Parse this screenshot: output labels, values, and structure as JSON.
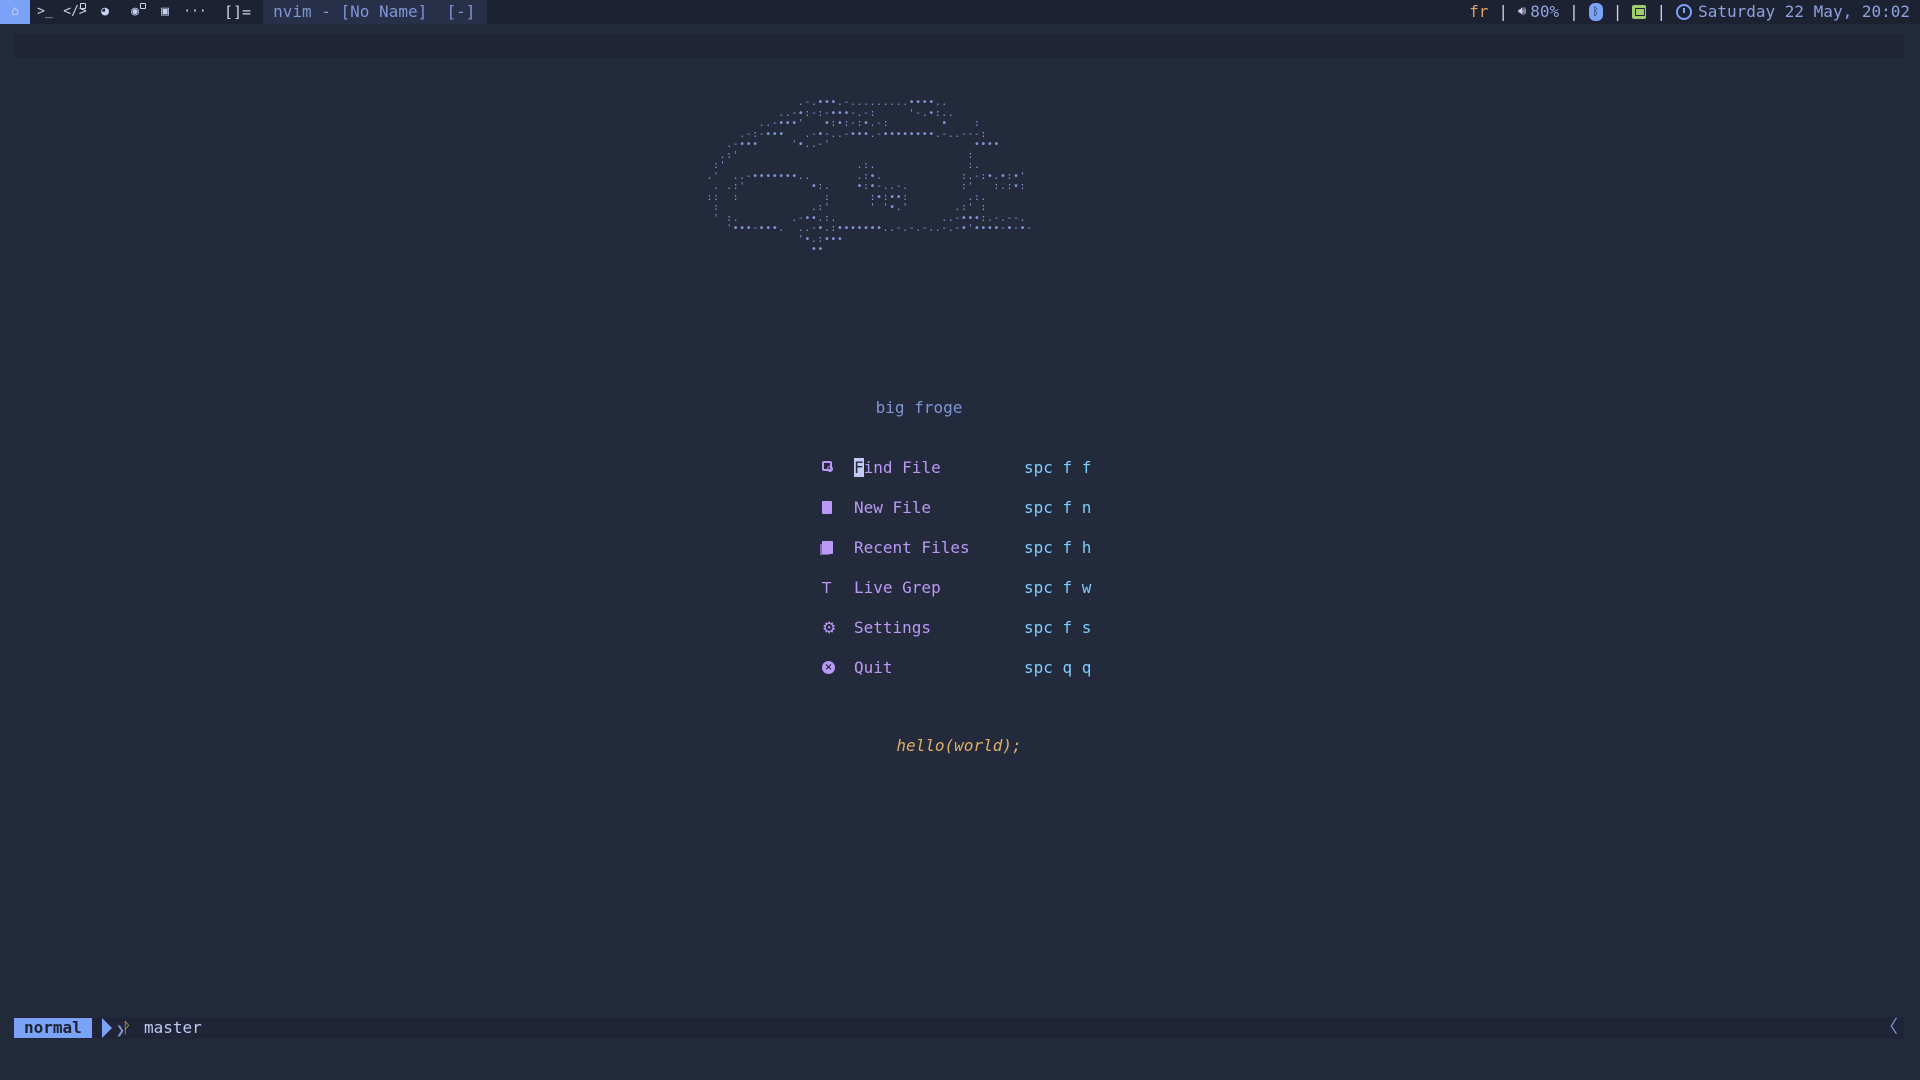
{
  "topbar": {
    "workspaces": [
      {
        "name": "home",
        "glyph": "⌂",
        "active": true
      },
      {
        "name": "terminal",
        "glyph": ">_",
        "active": false
      },
      {
        "name": "code",
        "glyph": "</>",
        "active": false
      },
      {
        "name": "browser",
        "glyph": "◕",
        "active": false
      },
      {
        "name": "steam",
        "glyph": "◉",
        "active": false
      },
      {
        "name": "discord",
        "glyph": "▣",
        "active": false
      },
      {
        "name": "more",
        "glyph": "···",
        "active": false
      }
    ],
    "layout_symbol": "[]=",
    "window_title": "nvim - [No Name]  [-]",
    "keyboard_layout": "fr",
    "volume": "80%",
    "separator": "|",
    "datetime": "Saturday 22 May, 20:02",
    "icons": [
      "home-icon",
      "terminal-icon",
      "code-icon",
      "firefox-icon",
      "steam-icon",
      "discord-icon",
      "volume-icon",
      "bluetooth-icon",
      "monitor-icon",
      "clock-icon"
    ]
  },
  "dashboard": {
    "ascii_art": "               .-.•••.-.........••••..\n            ..-•:-:-•••-.-:     '-.•:..\n         ..-•••'   •:•:-:•.-:        •    :\n      .-:-•••   .-•-..-•••.-••••••••.-..---:\n    .-•••     '•..-'                      ••••\n   .:'                                   :\n  :'                    .:.              :.\n .'  ..-•••••••..       .:•.            :.-:•.•:•'\n  . .:'          •:.    •:•-..-.        :'   :.:•:\n ::  :             :      :•:••:         .:.\n  :              .:'      ' '•.'       .:' :\n  ' :.        .-••.:.                ..-•••:.-.--.\n    '•••-•••.  ..-•.:•••••••..-.-.-..-.-•'••••-•-•-\n               '•.:•••\n                 ••",
    "caption": "big froge",
    "menu": [
      {
        "icon": "search-file-icon",
        "label": "Find File",
        "key": "spc f f"
      },
      {
        "icon": "new-file-icon",
        "label": "New File",
        "key": "spc f n"
      },
      {
        "icon": "recent-files-icon",
        "label": "Recent Files",
        "key": "spc f h"
      },
      {
        "icon": "text-grep-icon",
        "label": "Live Grep",
        "key": "spc f w"
      },
      {
        "icon": "gear-icon",
        "label": "Settings",
        "key": "spc f s"
      },
      {
        "icon": "close-circle-icon",
        "label": "Quit",
        "key": "spc q q"
      }
    ],
    "footer": "hello(world);"
  },
  "statusline": {
    "mode": "normal",
    "branch": "master",
    "right_glyph": "〈"
  },
  "colors": {
    "background": "#232a3b",
    "accent": "#7aa2f7",
    "menu_text": "#bb9af7",
    "keys": "#7dcfff",
    "footer": "#e0af68"
  }
}
